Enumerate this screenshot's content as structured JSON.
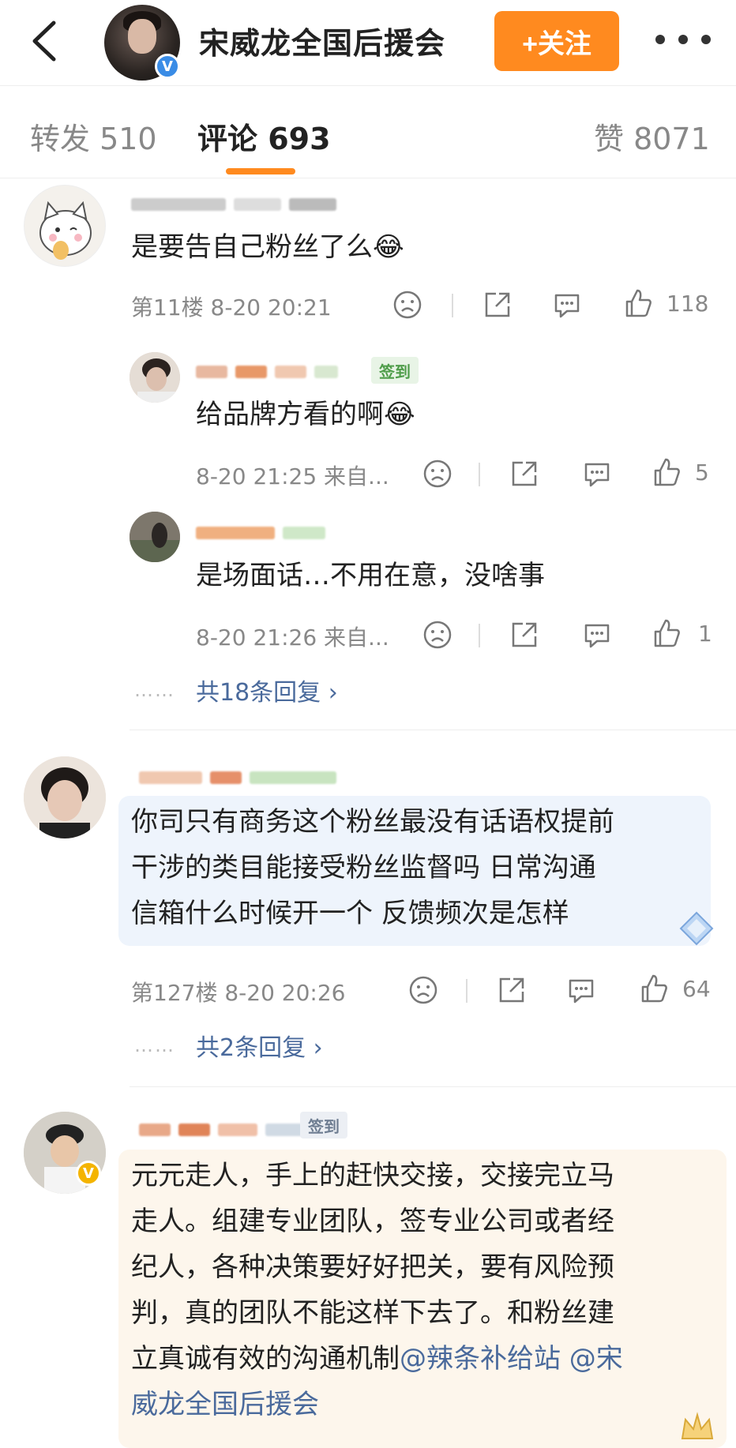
{
  "header": {
    "title": "宋威龙全国后援会",
    "follow_label": "+关注",
    "verified_mark": "V"
  },
  "tabs": [
    {
      "label": "转发 510"
    },
    {
      "label": "评论 693"
    },
    {
      "label": "赞 8071"
    }
  ],
  "comments": [
    {
      "text": "是要告自己粉丝了么😂",
      "meta": "第11楼  8-20 20:21",
      "likes": "118",
      "replies": [
        {
          "badge": "签到",
          "text": "给品牌方看的啊😂",
          "meta": "8-20 21:25 来自...",
          "likes": "5"
        },
        {
          "text": "是场面话…不用在意，没啥事",
          "meta": "8-20 21:26 来自...",
          "likes": "1"
        }
      ],
      "more_replies": "共18条回复 ›"
    },
    {
      "text_lines": [
        "你司只有商务这个粉丝最没有话语权提前",
        "干涉的类目能接受粉丝监督吗 日常沟通",
        "信箱什么时候开一个 反馈频次是怎样"
      ],
      "meta": "第127楼  8-20 20:26",
      "likes": "64",
      "more_replies": "共2条回复 ›"
    },
    {
      "badge": "签到",
      "text_lines": [
        "元元走人，手上的赶快交接，交接完立马",
        "走人。组建专业团队，签专业公司或者经",
        "纪人，各种决策要好好把关，要有风险预",
        "判，真的团队不能这样下去了。和粉丝建"
      ],
      "line5_plain": "立真诚有效的沟通机制",
      "line5_link1": "@辣条补给站",
      "line5_link2": " @宋",
      "line6_link": "威龙全国后援会"
    }
  ],
  "dots_text": "……",
  "colors": {
    "accent": "#ff8a1f",
    "link": "#4a6a9c",
    "verified": "#3a8ce6"
  }
}
